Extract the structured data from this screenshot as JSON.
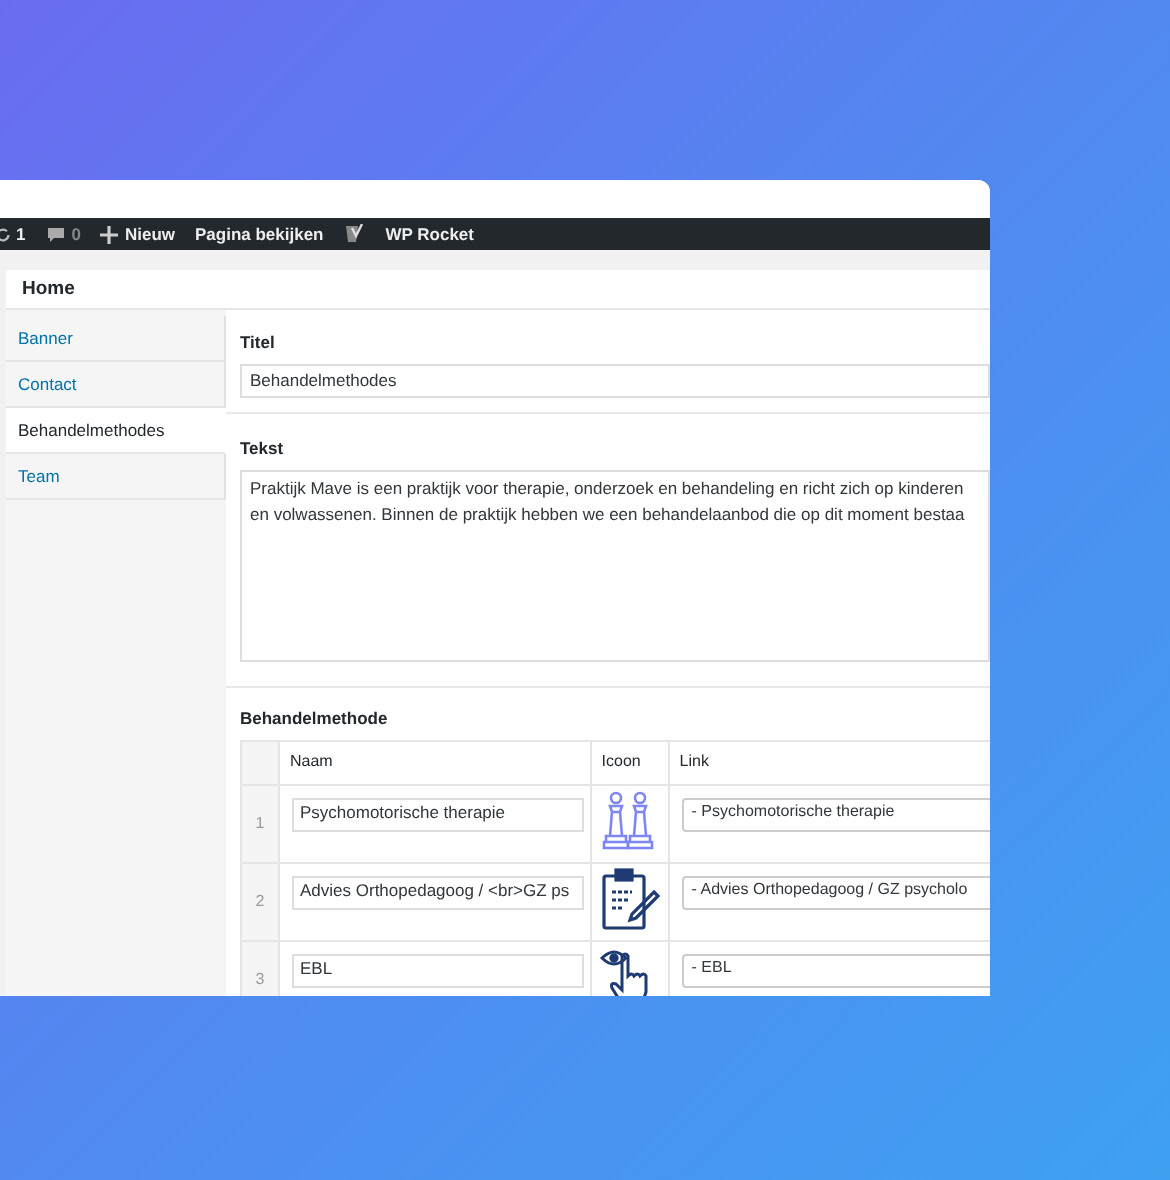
{
  "admin_bar": [
    {
      "kind": "updates",
      "label": "1"
    },
    {
      "kind": "comments",
      "label": "0"
    },
    {
      "kind": "new",
      "label": "Nieuw"
    },
    {
      "kind": "text",
      "label": "Pagina bekijken"
    },
    {
      "kind": "seo"
    },
    {
      "kind": "text",
      "label": "WP Rocket"
    }
  ],
  "page_title": "Home",
  "tabs": [
    {
      "label": "Banner",
      "selected": false
    },
    {
      "label": "Contact",
      "selected": false
    },
    {
      "label": "Behandelmethodes",
      "selected": true
    },
    {
      "label": "Team",
      "selected": false
    }
  ],
  "titel": {
    "label": "Titel",
    "value": "Behandelmethodes"
  },
  "tekst": {
    "label": "Tekst",
    "lines": [
      "Praktijk Mave is een praktijk voor therapie, onderzoek en behandeling en richt zich op kinderen",
      "en volwassenen. Binnen de praktijk hebben we een behandelaanbod die op dit moment bestaa"
    ]
  },
  "repeater": {
    "label": "Behandelmethode",
    "columns": [
      "Naam",
      "Icoon",
      "Link"
    ],
    "rows": [
      {
        "index": "1",
        "naam": "Psychomotorische therapie",
        "kind": "chess",
        "link": "- Psychomotorische therapie"
      },
      {
        "index": "2",
        "naam": "Advies Orthopedagoog / <br>GZ ps",
        "kind": "clipboard",
        "link": "- Advies Orthopedagoog / GZ psycholo"
      },
      {
        "index": "3",
        "naam": "EBL",
        "kind": "hand",
        "link": "- EBL"
      }
    ]
  }
}
